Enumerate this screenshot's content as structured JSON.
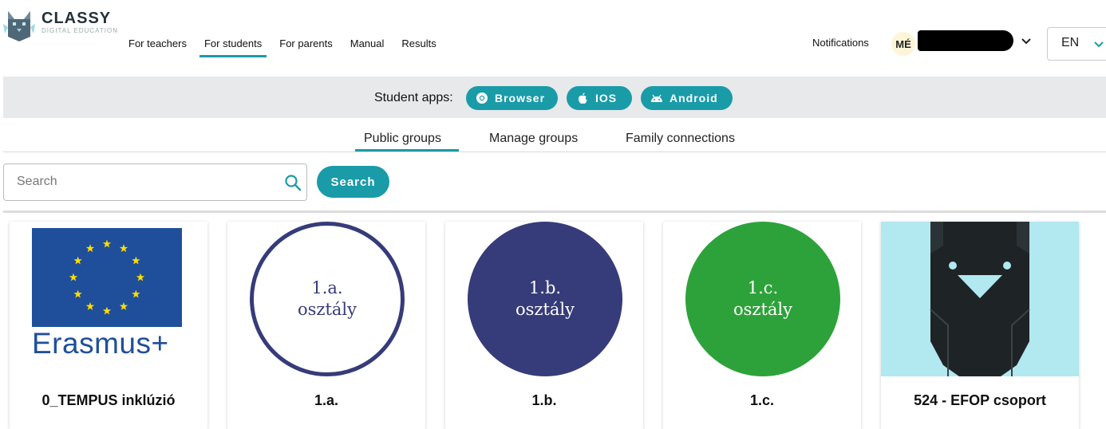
{
  "header": {
    "logo_text": "CLASSY",
    "logo_subtext": "DIGITAL EDUCATION",
    "nav": [
      {
        "label": "For teachers",
        "active": false
      },
      {
        "label": "For students",
        "active": true
      },
      {
        "label": "For parents",
        "active": false
      },
      {
        "label": "Manual",
        "active": false
      },
      {
        "label": "Results",
        "active": false
      }
    ],
    "notifications_label": "Notifications",
    "avatar_initials": "MÉ",
    "language": "EN"
  },
  "app_bar": {
    "label": "Student apps:",
    "buttons": [
      {
        "label": "Browser",
        "icon": "chrome-icon"
      },
      {
        "label": "IOS",
        "icon": "apple-icon"
      },
      {
        "label": "Android",
        "icon": "android-icon"
      }
    ]
  },
  "tabs": [
    {
      "label": "Public groups",
      "active": true
    },
    {
      "label": "Manage groups",
      "active": false
    },
    {
      "label": "Family connections",
      "active": false
    }
  ],
  "search": {
    "placeholder": "Search",
    "value": "",
    "button_label": "Search"
  },
  "groups": [
    {
      "title": "0_TEMPUS inklúzió",
      "image": "erasmus-logo",
      "logo_text": "Erasmus+"
    },
    {
      "title": "1.a.",
      "image": "circle-outline",
      "circle_text_1": "1.a.",
      "circle_text_2": "osztály",
      "color": "#363b79"
    },
    {
      "title": "1.b.",
      "image": "circle-filled",
      "circle_text_1": "1.b.",
      "circle_text_2": "osztály",
      "color": "#363b79"
    },
    {
      "title": "1.c.",
      "image": "circle-filled",
      "circle_text_1": "1.c.",
      "circle_text_2": "osztály",
      "color": "#2ea23a"
    },
    {
      "title": "524 - EFOP csoport",
      "image": "robot-mascot"
    }
  ],
  "colors": {
    "accent": "#1a9ba8",
    "app_bar_bg": "#e7e9eb",
    "navy": "#363b79",
    "green": "#2ea23a",
    "erasmus_blue": "#1f4f9a",
    "efop_bg": "#b2e8f0"
  }
}
